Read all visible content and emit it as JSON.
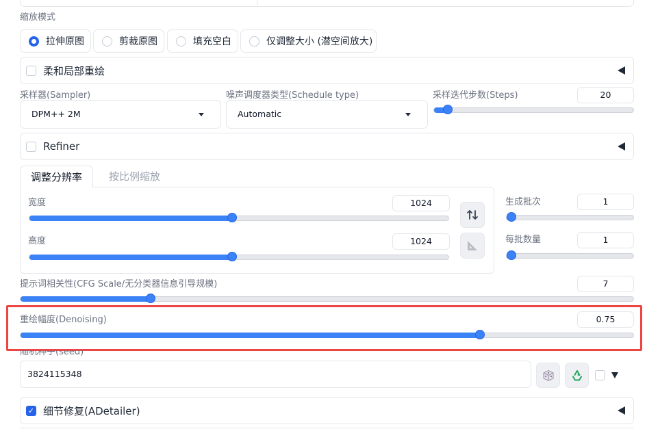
{
  "resize_mode": {
    "label": "缩放模式",
    "options": [
      "拉伸原图",
      "剪裁原图",
      "填充空白",
      "仅调整大小 (潜空间放大)"
    ],
    "selected": "拉伸原图"
  },
  "soft_inpainting": {
    "label": "柔和局部重绘",
    "checked": false
  },
  "sampler": {
    "label": "采样器(Sampler)",
    "value": "DPM++ 2M"
  },
  "schedule_type": {
    "label": "噪声调度器类型(Schedule type)",
    "value": "Automatic"
  },
  "steps": {
    "label": "采样迭代步数(Steps)",
    "value": "20",
    "fraction": 0.07
  },
  "refiner": {
    "label": "Refiner",
    "checked": false
  },
  "tabs": {
    "resize_to": "调整分辨率",
    "resize_by": "按比例缩放",
    "active": "调整分辨率"
  },
  "width": {
    "label": "宽度",
    "value": "1024",
    "fraction": 0.484
  },
  "height": {
    "label": "高度",
    "value": "1024",
    "fraction": 0.484
  },
  "batch_count": {
    "label": "生成批次",
    "value": "1",
    "fraction": 0.0
  },
  "batch_size": {
    "label": "每批数量",
    "value": "1",
    "fraction": 0.0
  },
  "cfg_scale": {
    "label": "提示词相关性(CFG Scale/无分类器信息引导规模)",
    "value": "7",
    "fraction": 0.212
  },
  "denoising": {
    "label": "重绘幅度(Denoising)",
    "value": "0.75",
    "fraction": 0.75
  },
  "seed": {
    "label": "随机种子(seed)",
    "value": "3824115348"
  },
  "adetailer": {
    "label": "细节修复(ADetailer)",
    "checked": true
  },
  "icons": {
    "swap": "swap-dimensions-icon",
    "ratio": "triangle-ruler-icon",
    "dice": "dice-icon",
    "recycle": "recycle-icon"
  },
  "colors": {
    "accent": "#3b82f6",
    "highlight": "#ef4444"
  }
}
